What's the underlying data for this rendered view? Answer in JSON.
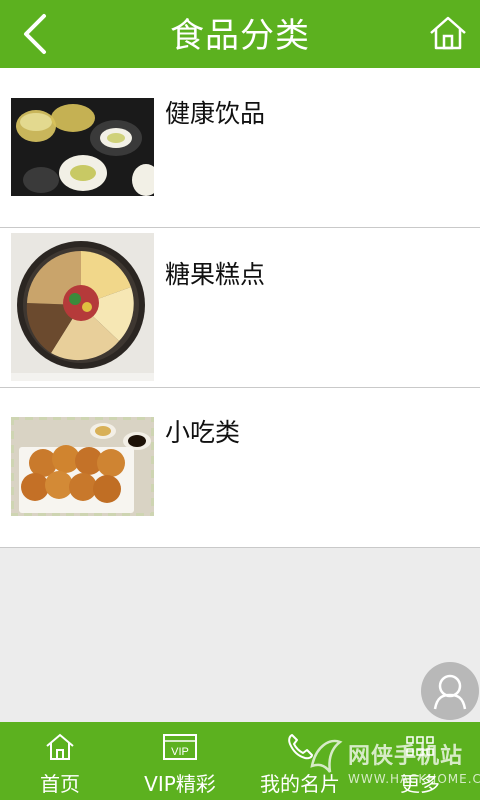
{
  "header": {
    "title": "食品分类",
    "back_icon": "chevron-left-icon",
    "home_icon": "home-icon"
  },
  "categories": [
    {
      "label": "健康饮品",
      "image": "tea-cups-photo"
    },
    {
      "label": "糖果糕点",
      "image": "candy-nuts-tray-photo"
    },
    {
      "label": "小吃类",
      "image": "fried-cakes-plate-photo"
    }
  ],
  "fab": {
    "icon": "contact-avatar-icon"
  },
  "tabbar": [
    {
      "label": "首页",
      "icon": "home-icon"
    },
    {
      "label": "VIP精彩",
      "icon": "vip-icon"
    },
    {
      "label": "我的名片",
      "icon": "phone-icon"
    },
    {
      "label": "更多",
      "icon": "grid-icon"
    }
  ],
  "watermark": {
    "main": "网侠手机站",
    "sub": "WWW.HACKHOME.COM"
  },
  "colors": {
    "brand": "#5cb11f",
    "background": "#ececec"
  }
}
